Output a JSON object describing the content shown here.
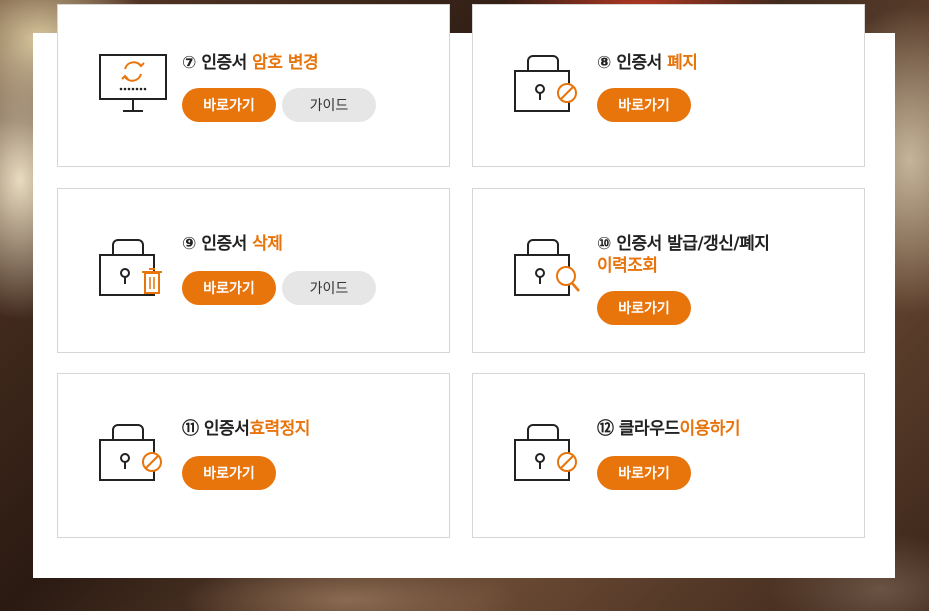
{
  "accent_color": "#e8740c",
  "cards": [
    {
      "number": "⑦",
      "title_plain": "인증서 ",
      "title_highlight": "암호 변경",
      "title_line2": "",
      "go_label": "바로가기",
      "guide_label": "가이드",
      "icon": "monitor-refresh-icon"
    },
    {
      "number": "⑧",
      "title_plain": "인증서 ",
      "title_highlight": "폐지",
      "title_line2": "",
      "go_label": "바로가기",
      "icon": "lock-prohibited-icon"
    },
    {
      "number": "⑨",
      "title_plain": "인증서 ",
      "title_highlight": "삭제",
      "title_line2": "",
      "go_label": "바로가기",
      "guide_label": "가이드",
      "icon": "lock-trash-icon"
    },
    {
      "number": "⑩",
      "title_plain": "인증서 발급/갱신/폐지",
      "title_highlight": "",
      "title_line2": "이력조회",
      "go_label": "바로가기",
      "icon": "lock-search-icon"
    },
    {
      "number": "⑪",
      "title_plain": " 인증서",
      "title_highlight": "효력정지",
      "title_line2": "",
      "go_label": "바로가기",
      "icon": "lock-prohibited-icon"
    },
    {
      "number": "⑫",
      "title_plain": "클라우드",
      "title_highlight": "이용하기",
      "title_line2": "",
      "go_label": "바로가기",
      "icon": "lock-prohibited-icon"
    }
  ]
}
